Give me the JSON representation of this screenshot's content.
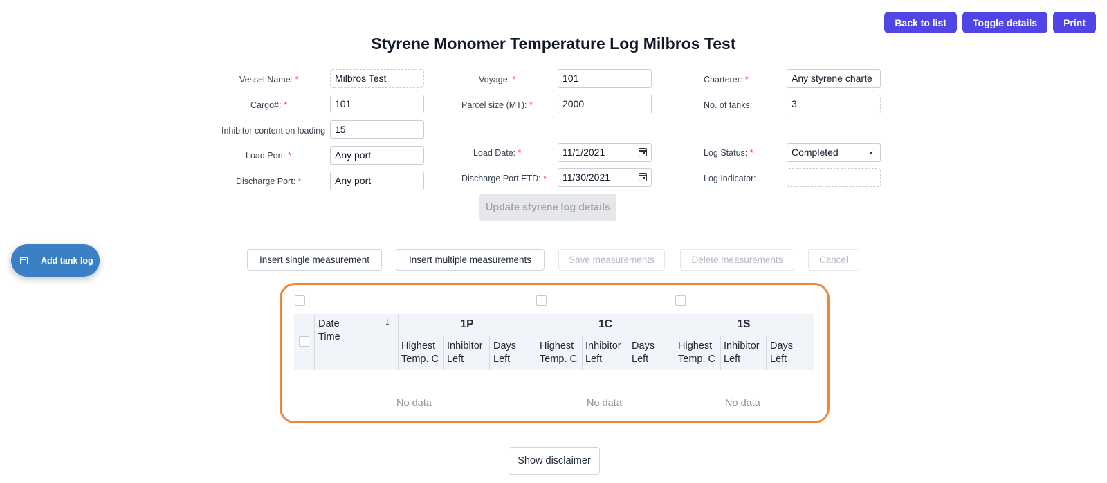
{
  "header": {
    "back_label": "Back to list",
    "toggle_label": "Toggle details",
    "print_label": "Print",
    "title": "Styrene Monomer Temperature Log Milbros Test"
  },
  "form": {
    "vessel_name": {
      "label": "Vessel Name:",
      "value": "Milbros Test"
    },
    "cargo": {
      "label": "Cargo#:",
      "value": "101"
    },
    "inhibitor": {
      "label": "Inhibitor content on loading",
      "value": "15"
    },
    "load_port": {
      "label": "Load Port:",
      "value": "Any port"
    },
    "discharge_port": {
      "label": "Discharge Port:",
      "value": "Any port"
    },
    "voyage": {
      "label": "Voyage:",
      "value": "101"
    },
    "parcel_size": {
      "label": "Parcel size (MT):",
      "value": "2000"
    },
    "load_date": {
      "label": "Load Date:",
      "value": "11/1/2021"
    },
    "discharge_etd": {
      "label": "Discharge Port ETD:",
      "value": "11/30/2021"
    },
    "charterer": {
      "label": "Charterer:",
      "value": "Any styrene charte"
    },
    "tanks": {
      "label": "No. of tanks:",
      "value": "3"
    },
    "log_status": {
      "label": "Log Status:",
      "value": "Completed"
    },
    "log_indicator": {
      "label": "Log Indicator:",
      "value": ""
    },
    "required_mark": "*",
    "update_label": "Update styrene log details"
  },
  "fab": {
    "label": "Add tank log",
    "icon": "table-icon"
  },
  "toolbar": {
    "insert_single": "Insert single measurement",
    "insert_multiple": "Insert multiple measurements",
    "save": "Save measurements",
    "delete": "Delete measurements",
    "cancel": "Cancel"
  },
  "table": {
    "date_header": "Date\nTime",
    "groups": [
      {
        "name": "1P",
        "cols": [
          "Highest\nTemp. C",
          "Inhibitor\nLeft",
          "Days\nLeft"
        ],
        "empty": "No data"
      },
      {
        "name": "1C",
        "cols": [
          "Highest\nTemp. C",
          "Inhibitor\nLeft",
          "Days\nLeft"
        ],
        "empty": "No data"
      },
      {
        "name": "1S",
        "cols": [
          "Highest\nTemp. C",
          "Inhibitor\nLeft",
          "Days\nLeft"
        ],
        "empty": "No data"
      }
    ],
    "sort_icon": "arrow-down-icon"
  },
  "footer": {
    "disclaimer_label": "Show disclaimer"
  }
}
